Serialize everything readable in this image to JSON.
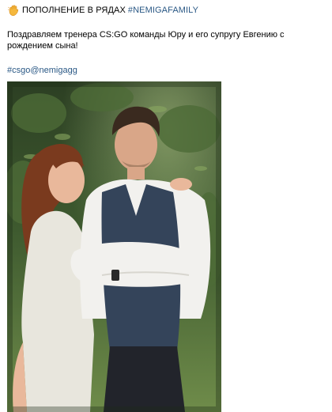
{
  "post": {
    "headline_text": "ПОПОЛНЕНИЕ В РЯДАХ",
    "headline_hashtag": "#NEMIGAFAMILY",
    "headline_icon": "waving-hand-emoji-icon",
    "message": "Поздравляем тренера CS:GO команды Юру и его супругу Евгению с рождением сына!",
    "hashtag": "#csgo@nemigagg",
    "photo_icon": "couple-photo"
  },
  "colors": {
    "text": "#000000",
    "link": "#2a5885",
    "background": "#ffffff"
  }
}
